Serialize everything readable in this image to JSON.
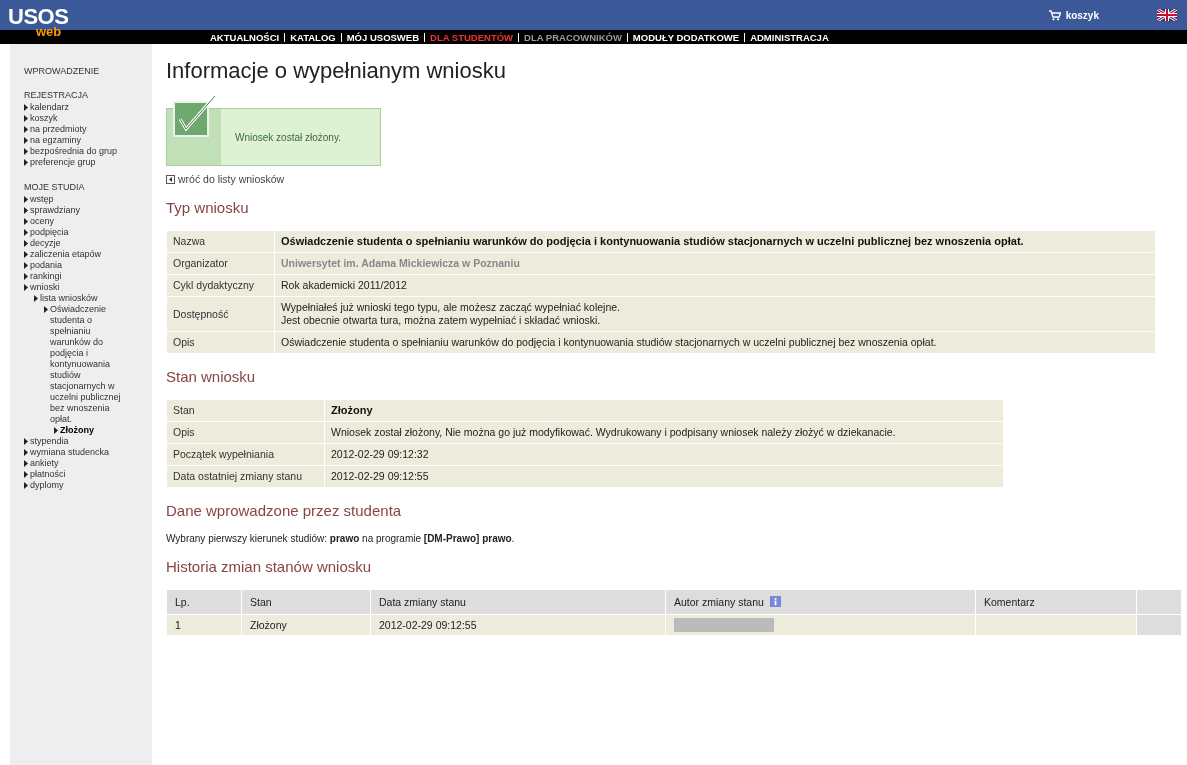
{
  "header": {
    "logo_top": "USOS",
    "logo_bottom": "web",
    "cart": "koszyk",
    "nav": [
      {
        "label": "AKTUALNOŚCI",
        "selected": false,
        "disabled": false
      },
      {
        "label": "KATALOG",
        "selected": false,
        "disabled": false
      },
      {
        "label": "MÓJ USOSWEB",
        "selected": false,
        "disabled": false
      },
      {
        "label": "DLA STUDENTÓW",
        "selected": true,
        "disabled": false
      },
      {
        "label": "DLA PRACOWNIKÓW",
        "selected": false,
        "disabled": true
      },
      {
        "label": "MODUŁY DODATKOWE",
        "selected": false,
        "disabled": false
      },
      {
        "label": "ADMINISTRACJA",
        "selected": false,
        "disabled": false
      }
    ]
  },
  "sidebar": {
    "sections": [
      {
        "title": "WPROWADZENIE"
      },
      {
        "title": "REJESTRACJA",
        "items": [
          {
            "label": "kalendarz",
            "selected": false
          },
          {
            "label": "koszyk",
            "selected": false
          },
          {
            "label": "na przedmioty",
            "selected": false
          },
          {
            "label": "na egzaminy",
            "selected": false
          },
          {
            "label": "bezpośrednia do grup",
            "selected": false
          },
          {
            "label": "preferencje grup",
            "selected": false
          }
        ]
      },
      {
        "title": "MOJE STUDIA",
        "items": [
          {
            "label": "wstęp",
            "selected": false
          },
          {
            "label": "sprawdziany",
            "selected": false
          },
          {
            "label": "oceny",
            "selected": false
          },
          {
            "label": "podpięcia",
            "selected": false
          },
          {
            "label": "decyzje",
            "selected": false
          },
          {
            "label": "zaliczenia etapów",
            "selected": false
          },
          {
            "label": "podania",
            "selected": false
          },
          {
            "label": "rankingi",
            "selected": false
          },
          {
            "label": "wnioski",
            "selected": false,
            "children": [
              {
                "label": "lista wniosków",
                "selected": false,
                "children": [
                  {
                    "label": "Oświadczenie studenta o spełnianiu warunków do podjęcia i kontynuowania studiów stacjonarnych w uczelni publicznej bez wnoszenia opłat.",
                    "selected": false,
                    "children": [
                      {
                        "label": "Złożony",
                        "selected": true
                      }
                    ]
                  }
                ]
              }
            ]
          },
          {
            "label": "stypendia",
            "selected": false
          },
          {
            "label": "wymiana studencka",
            "selected": false
          },
          {
            "label": "ankiety",
            "selected": false
          },
          {
            "label": "płatności",
            "selected": false
          },
          {
            "label": "dyplomy",
            "selected": false
          }
        ]
      }
    ]
  },
  "page_title": "Informacje o wypełnianym wniosku",
  "success_message": "Wniosek został złożony.",
  "back_link": "wróć do listy wniosków",
  "type_section": {
    "heading": "Typ wniosku",
    "rows": [
      {
        "label": "Nazwa",
        "value": "Oświadczenie studenta o spełnianiu warunków do podjęcia i kontynuowania studiów stacjonarnych w uczelni publicznej bez wnoszenia opłat.",
        "kind": "bold"
      },
      {
        "label": "Organizator",
        "value": "Uniwersytet im. Adama Mickiewicza w Poznaniu",
        "kind": "muted"
      },
      {
        "label": "Cykl dydaktyczny",
        "value": "Rok akademicki 2011/2012",
        "kind": "plain"
      },
      {
        "label": "Dostępność",
        "value": "Wypełniałeś już wnioski tego typu, ale możesz zacząć wypełniać kolejne.\nJest obecnie otwarta tura, można zatem wypełniać i składać wnioski.",
        "kind": "plain"
      },
      {
        "label": "Opis",
        "value": "Oświadczenie studenta o spełnianiu warunków do podjęcia i kontynuowania studiów stacjonarnych w uczelni publicznej bez wnoszenia opłat.",
        "kind": "plain"
      }
    ]
  },
  "state_section": {
    "heading": "Stan wniosku",
    "rows": [
      {
        "label": "Stan",
        "value": "Złożony",
        "kind": "bold"
      },
      {
        "label": "Opis",
        "value": "Wniosek został złożony, Nie można go już modyfikować. Wydrukowany i podpisany wniosek należy złożyć w dziekanacie.",
        "kind": "plain"
      },
      {
        "label": "Początek wypełniania",
        "value": "2012-02-29 09:12:32",
        "kind": "plain"
      },
      {
        "label": "Data ostatniej zmiany stanu",
        "value": "2012-02-29 09:12:55",
        "kind": "plain"
      }
    ]
  },
  "student_section": {
    "heading": "Dane wprowadzone przez studenta",
    "text": "Wybrany pierwszy kierunek studiów: **prawo** na programie **[DM-Prawo] prawo**."
  },
  "history_section": {
    "heading": "Historia zmian stanów wniosku",
    "columns": [
      {
        "label": "Lp.",
        "info": false
      },
      {
        "label": "Stan",
        "info": false
      },
      {
        "label": "Data zmiany stanu",
        "info": false
      },
      {
        "label": "Autor zmiany stanu",
        "info": true
      },
      {
        "label": "Komentarz",
        "info": false
      }
    ],
    "rows": [
      {
        "number": "1",
        "state": "Złożony",
        "date": "2012-02-29 09:12:55",
        "author_redacted": true
      }
    ]
  }
}
